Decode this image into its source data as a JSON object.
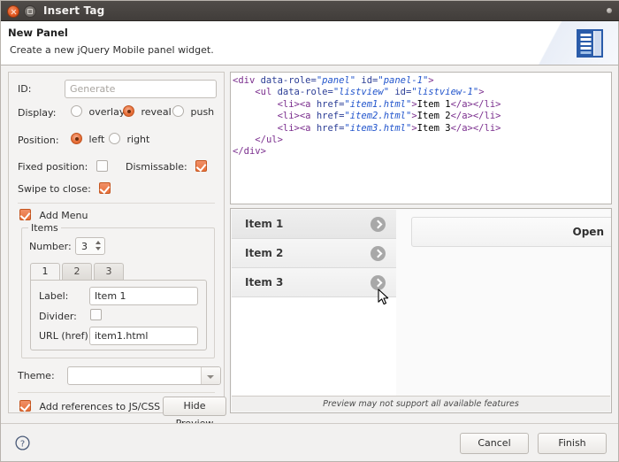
{
  "window": {
    "title": "Insert Tag",
    "close_icon": "close-icon",
    "maximize_icon": "maximize-icon",
    "menu_icon": "window-menu-icon"
  },
  "header": {
    "title": "New Panel",
    "subtitle": "Create a new jQuery Mobile panel widget.",
    "icon": "panel-widget-icon"
  },
  "form": {
    "id": {
      "label": "ID:",
      "value": "",
      "placeholder": "Generate"
    },
    "display": {
      "label": "Display:",
      "options": [
        "overlay",
        "reveal",
        "push"
      ],
      "selected": "reveal"
    },
    "position": {
      "label": "Position:",
      "options": [
        "left",
        "right"
      ],
      "selected": "left"
    },
    "fixed_position": {
      "label": "Fixed position:",
      "checked": false
    },
    "dismissable": {
      "label": "Dismissable:",
      "checked": true
    },
    "swipe_to_close": {
      "label": "Swipe to close:",
      "checked": true
    },
    "add_menu": {
      "label": "Add Menu",
      "checked": true
    },
    "items": {
      "group_title": "Items",
      "number_label": "Number:",
      "number_value": "3",
      "tabs": [
        "1",
        "2",
        "3"
      ],
      "selected_tab": "1",
      "fields": {
        "label_label": "Label:",
        "label_value": "Item 1",
        "divider_label": "Divider:",
        "divider_checked": false,
        "url_label": "URL (href):",
        "url_value": "item1.html"
      }
    },
    "theme": {
      "label": "Theme:",
      "value": "",
      "dropdown_icon": "chevron-down-icon"
    },
    "add_references": {
      "label": "Add references to JS/CSS",
      "checked": true
    },
    "hide_preview_button": "Hide Preview"
  },
  "code": {
    "lines": [
      [
        {
          "t": "tag",
          "s": "<div "
        },
        {
          "t": "attr",
          "s": "data-role="
        },
        {
          "t": "val",
          "s": "\"panel\""
        },
        {
          "t": "attr",
          "s": " id="
        },
        {
          "t": "val",
          "s": "\"panel-1\""
        },
        {
          "t": "tag",
          "s": ">"
        }
      ],
      [
        {
          "t": "txt",
          "s": "    "
        },
        {
          "t": "tag",
          "s": "<ul "
        },
        {
          "t": "attr",
          "s": "data-role="
        },
        {
          "t": "val",
          "s": "\"listview\""
        },
        {
          "t": "attr",
          "s": " id="
        },
        {
          "t": "val",
          "s": "\"listview-1\""
        },
        {
          "t": "tag",
          "s": ">"
        }
      ],
      [
        {
          "t": "txt",
          "s": "        "
        },
        {
          "t": "tag",
          "s": "<li><a "
        },
        {
          "t": "attr",
          "s": "href="
        },
        {
          "t": "val",
          "s": "\"item1.html\""
        },
        {
          "t": "tag",
          "s": ">"
        },
        {
          "t": "txt",
          "s": "Item 1"
        },
        {
          "t": "tag",
          "s": "</a></li>"
        }
      ],
      [
        {
          "t": "txt",
          "s": "        "
        },
        {
          "t": "tag",
          "s": "<li><a "
        },
        {
          "t": "attr",
          "s": "href="
        },
        {
          "t": "val",
          "s": "\"item2.html\""
        },
        {
          "t": "tag",
          "s": ">"
        },
        {
          "t": "txt",
          "s": "Item 2"
        },
        {
          "t": "tag",
          "s": "</a></li>"
        }
      ],
      [
        {
          "t": "txt",
          "s": "        "
        },
        {
          "t": "tag",
          "s": "<li><a "
        },
        {
          "t": "attr",
          "s": "href="
        },
        {
          "t": "val",
          "s": "\"item3.html\""
        },
        {
          "t": "tag",
          "s": ">"
        },
        {
          "t": "txt",
          "s": "Item 3"
        },
        {
          "t": "tag",
          "s": "</a></li>"
        }
      ],
      [
        {
          "t": "txt",
          "s": "    "
        },
        {
          "t": "tag",
          "s": "</ul>"
        }
      ],
      [
        {
          "t": "tag",
          "s": "</div>"
        }
      ]
    ]
  },
  "preview": {
    "items": [
      "Item 1",
      "Item 2",
      "Item 3"
    ],
    "highlighted_item": "Item 1",
    "header_button": "Open",
    "footnote": "Preview may not support all available features",
    "arrow_icon": "chevron-right-icon"
  },
  "footer": {
    "help_icon": "help-icon",
    "cancel_label": "Cancel",
    "finish_label": "Finish"
  },
  "colors": {
    "accent": "#e8703a",
    "titlebar": "#443f3c",
    "dialog_bg": "#f2f1f0",
    "code_tag": "#7b2f8e",
    "code_attr": "#2c3e96",
    "code_value": "#2255cc",
    "icon_blue": "#2a5caa"
  }
}
